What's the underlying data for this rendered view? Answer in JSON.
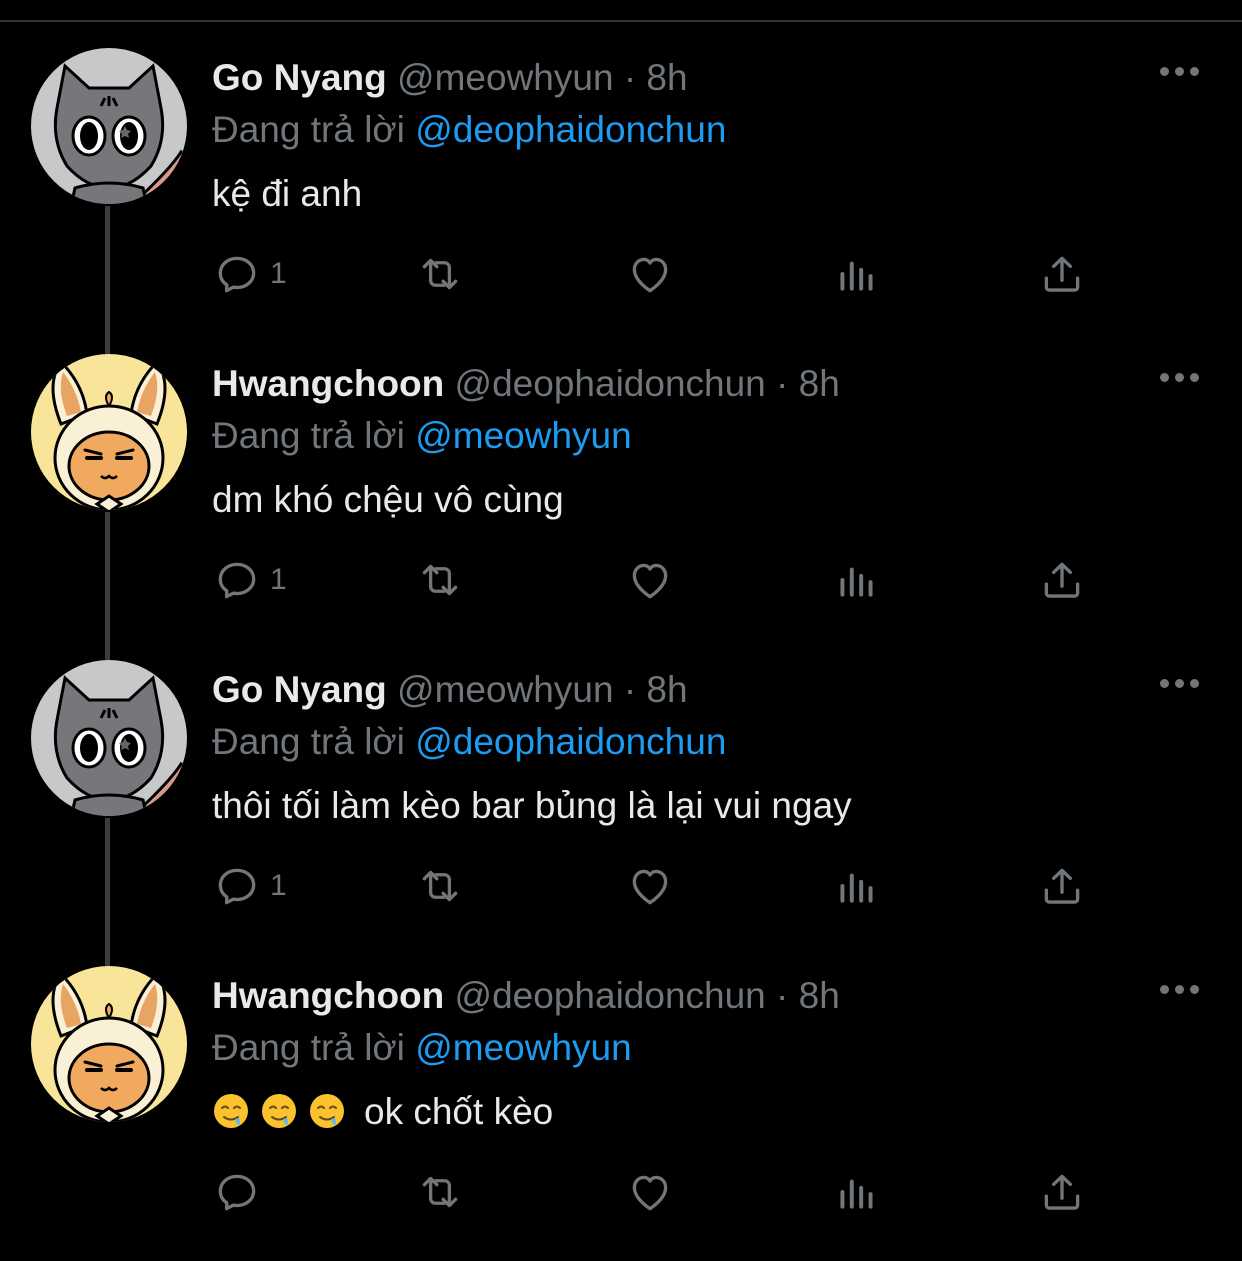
{
  "tweets": [
    {
      "name": "Go Nyang",
      "handle": "@meowhyun",
      "separator": "·",
      "time": "8h",
      "reply_prefix": "Đang trả lời",
      "reply_to": "@deophaidonchun",
      "text": "kệ đi anh",
      "reply_count": "1",
      "avatar": "cat-avatar"
    },
    {
      "name": "Hwangchoon",
      "handle": "@deophaidonchun",
      "separator": "·",
      "time": "8h",
      "reply_prefix": "Đang trả lời",
      "reply_to": "@meowhyun",
      "text": "dm khó chệu vô cùng",
      "reply_count": "1",
      "avatar": "bunny-avatar"
    },
    {
      "name": "Go Nyang",
      "handle": "@meowhyun",
      "separator": "·",
      "time": "8h",
      "reply_prefix": "Đang trả lời",
      "reply_to": "@deophaidonchun",
      "text": "thôi tối làm kèo bar bủng là lại vui ngay",
      "reply_count": "1",
      "avatar": "cat-avatar"
    },
    {
      "name": "Hwangchoon",
      "handle": "@deophaidonchun",
      "separator": "·",
      "time": "8h",
      "reply_prefix": "Đang trả lời",
      "reply_to": "@meowhyun",
      "text": "ok chốt kèo",
      "emojis": [
        "drooling-face",
        "drooling-face",
        "drooling-face"
      ],
      "reply_count": "",
      "avatar": "bunny-avatar"
    }
  ],
  "icons": {
    "reply": "reply-icon",
    "retweet": "retweet-icon",
    "like": "like-icon",
    "views": "views-icon",
    "share": "share-icon",
    "more": "more-icon"
  },
  "colors": {
    "background": "#000000",
    "text": "#e7e9ea",
    "secondary": "#71767b",
    "accent": "#1d9bf0",
    "thread_line": "#3a3d40"
  }
}
